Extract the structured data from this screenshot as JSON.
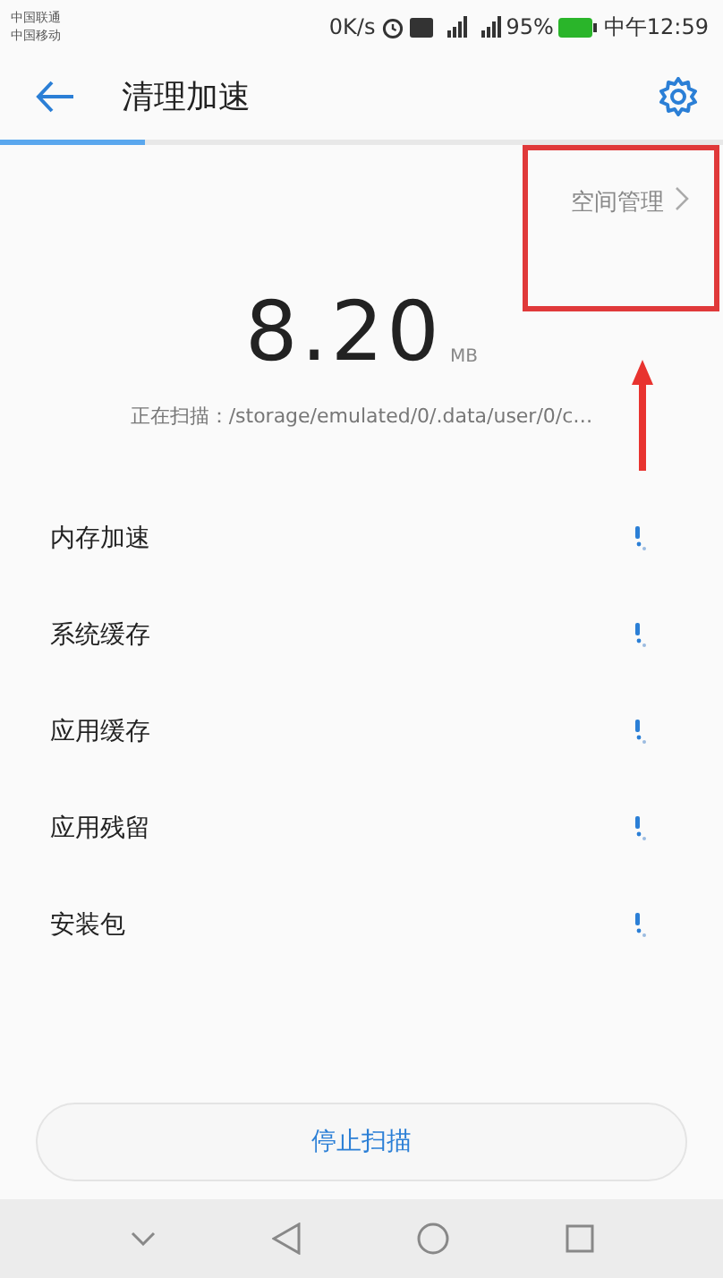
{
  "status_bar": {
    "carriers": [
      "中国联通",
      "中国移动"
    ],
    "speed": "0K/s",
    "battery": "95%",
    "time": "中午12:59"
  },
  "header": {
    "title": "清理加速"
  },
  "scan_progress": {
    "level": 0.2
  },
  "space_link": {
    "label": "空间管理"
  },
  "total": {
    "value": "8.20",
    "unit": "MB"
  },
  "scanning_text": "正在扫描：/storage/emulated/0/.data/user/0/c…",
  "items": [
    {
      "label": "内存加速"
    },
    {
      "label": "系统缓存"
    },
    {
      "label": "应用缓存"
    },
    {
      "label": "应用残留"
    },
    {
      "label": "安装包"
    }
  ],
  "stop_button": {
    "label": "停止扫描"
  }
}
